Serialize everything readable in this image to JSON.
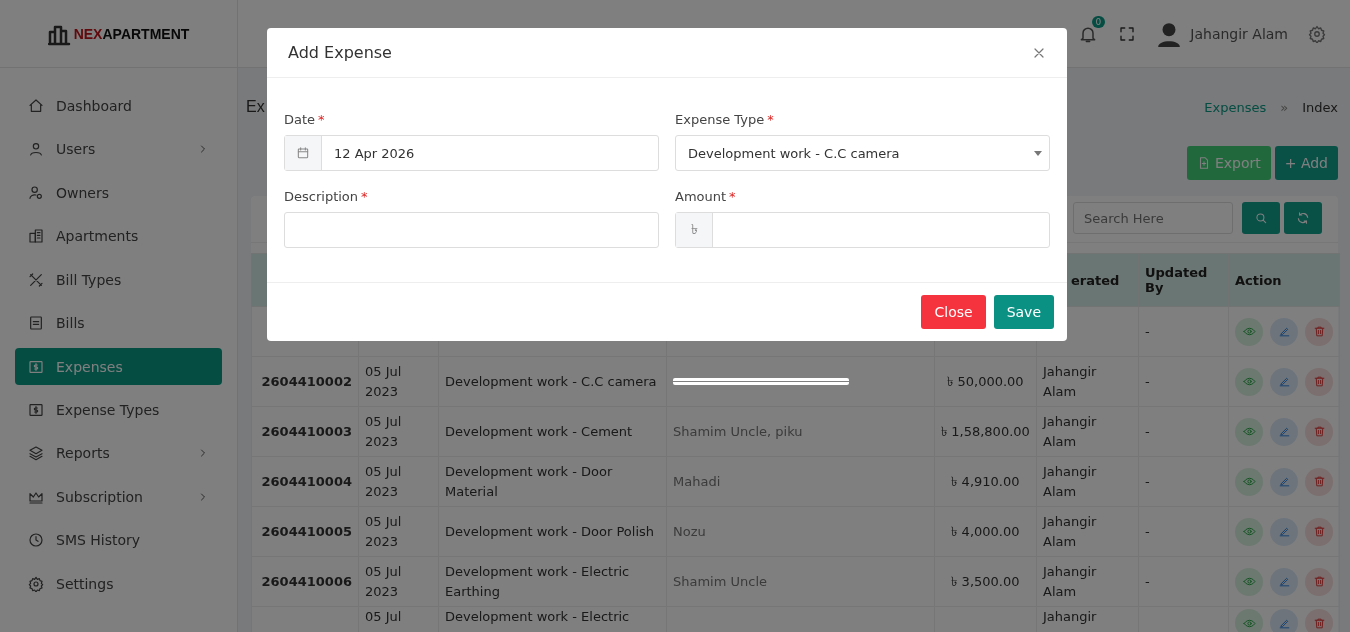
{
  "sidebar": {
    "logo": {
      "prefix": "NEX",
      "name": "APARTMENT"
    },
    "items": [
      {
        "label": "Dashboard",
        "selected": false,
        "has_submenu": false
      },
      {
        "label": "Users",
        "selected": false,
        "has_submenu": true
      },
      {
        "label": "Owners",
        "selected": false,
        "has_submenu": false
      },
      {
        "label": "Apartments",
        "selected": false,
        "has_submenu": false
      },
      {
        "label": "Bill Types",
        "selected": false,
        "has_submenu": false
      },
      {
        "label": "Bills",
        "selected": false,
        "has_submenu": false
      },
      {
        "label": "Expenses",
        "selected": true,
        "has_submenu": false
      },
      {
        "label": "Expense Types",
        "selected": false,
        "has_submenu": false
      },
      {
        "label": "Reports",
        "selected": false,
        "has_submenu": true
      },
      {
        "label": "Subscription",
        "selected": false,
        "has_submenu": true
      },
      {
        "label": "SMS History",
        "selected": false,
        "has_submenu": false
      },
      {
        "label": "Settings",
        "selected": false,
        "has_submenu": false
      }
    ]
  },
  "header": {
    "notification_count": "0",
    "user_name": "Jahangir Alam"
  },
  "page_title": "Ex",
  "breadcrumb": [
    {
      "label": "Expenses",
      "kind": "link"
    },
    {
      "label": "»",
      "kind": "separator"
    },
    {
      "label": "Index",
      "kind": "current"
    }
  ],
  "buttons": [
    {
      "label": "Export",
      "kind": "export"
    },
    {
      "label": "+ Add",
      "kind": "add"
    }
  ],
  "search": {
    "placeholder": "Search Here"
  },
  "table": {
    "columns": [
      "erated",
      "Updated By",
      "Action"
    ],
    "rows": [
      {
        "updated_by": "-"
      },
      {
        "id": "2604410002",
        "date": "05 Jul 2023",
        "expense_type": "Development work - C.C camera",
        "amount": "৳ 50,000.00",
        "generated_by": "Jahangir Alam",
        "updated_by": "-",
        "redacted": true
      },
      {
        "id": "2604410003",
        "date": "05 Jul 2023",
        "expense_type": "Development work - Cement",
        "column_4": "Shamim Uncle, piku",
        "amount": "৳ 1,58,800.00",
        "generated_by": "Jahangir Alam",
        "updated_by": "-"
      },
      {
        "id": "2604410004",
        "date": "05 Jul 2023",
        "expense_type": "Development work - Door Material",
        "column_4": "Mahadi",
        "amount": "৳ 4,910.00",
        "generated_by": "Jahangir Alam",
        "updated_by": "-"
      },
      {
        "id": "2604410005",
        "date": "05 Jul 2023",
        "expense_type": "Development work - Door Polish",
        "column_4": "Nozu",
        "amount": "৳ 4,000.00",
        "generated_by": "Jahangir Alam",
        "updated_by": "-"
      },
      {
        "id": "2604410006",
        "date": "05 Jul 2023",
        "expense_type": "Development work - Electric Earthing",
        "column_4": "Shamim Uncle",
        "amount": "৳ 3,500.00",
        "generated_by": "Jahangir Alam",
        "updated_by": "-"
      },
      {
        "date": "05 Jul",
        "expense_type": "Development work - Electric",
        "generated_by": "Jahangir"
      }
    ]
  },
  "modal": {
    "title": "Add Expense",
    "fields": [
      {
        "label": "Date",
        "required_mark": "*",
        "kind": "date",
        "value": "12 Apr 2026"
      },
      {
        "label": "Expense Type",
        "required_mark": "*",
        "kind": "select",
        "value": "Development work - C.C camera"
      },
      {
        "label": "Description",
        "required_mark": "*",
        "kind": "text"
      },
      {
        "label": "Amount",
        "required_mark": "*",
        "kind": "currency",
        "prefix": "৳"
      }
    ],
    "buttons": [
      {
        "label": "Close",
        "kind": "cancel"
      },
      {
        "label": "Save",
        "kind": "primary"
      }
    ]
  }
}
